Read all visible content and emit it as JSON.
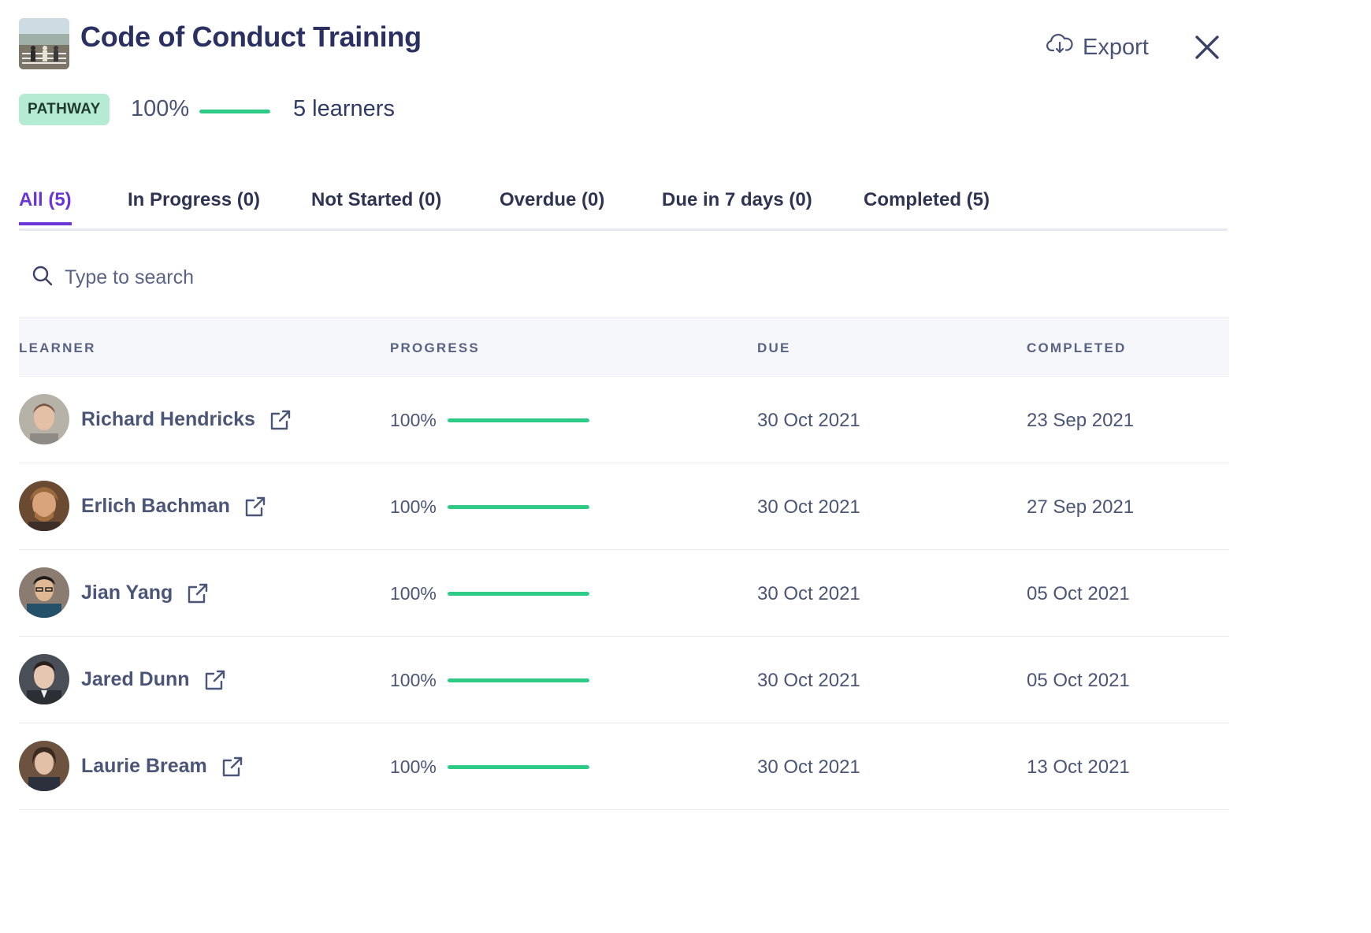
{
  "header": {
    "title": "Code of Conduct Training",
    "export_label": "Export",
    "badge": "PATHWAY",
    "overall_progress_label": "100%",
    "overall_progress_fraction": 1.0,
    "learners_label": "5 learners"
  },
  "tabs": [
    {
      "label": "All (5)",
      "active": true
    },
    {
      "label": "In Progress (0)",
      "active": false
    },
    {
      "label": "Not Started (0)",
      "active": false
    },
    {
      "label": "Overdue (0)",
      "active": false
    },
    {
      "label": "Due in 7 days (0)",
      "active": false
    },
    {
      "label": "Completed (5)",
      "active": false
    }
  ],
  "search": {
    "placeholder": "Type to search",
    "value": ""
  },
  "table": {
    "headers": [
      "LEARNER",
      "PROGRESS",
      "DUE",
      "COMPLETED"
    ],
    "rows": [
      {
        "name": "Richard Hendricks",
        "progress_label": "100%",
        "progress_fraction": 1.0,
        "due": "30 Oct 2021",
        "completed": "23 Sep 2021"
      },
      {
        "name": "Erlich Bachman",
        "progress_label": "100%",
        "progress_fraction": 1.0,
        "due": "30 Oct 2021",
        "completed": "27 Sep 2021"
      },
      {
        "name": "Jian Yang",
        "progress_label": "100%",
        "progress_fraction": 1.0,
        "due": "30 Oct 2021",
        "completed": "05 Oct 2021"
      },
      {
        "name": "Jared Dunn",
        "progress_label": "100%",
        "progress_fraction": 1.0,
        "due": "30 Oct 2021",
        "completed": "05 Oct 2021"
      },
      {
        "name": "Laurie Bream",
        "progress_label": "100%",
        "progress_fraction": 1.0,
        "due": "30 Oct 2021",
        "completed": "13 Oct 2021"
      }
    ]
  },
  "icons": {
    "export": "cloud-download-icon",
    "close": "close-icon",
    "search": "search-icon",
    "open_profile": "external-link-icon"
  },
  "colors": {
    "accent": "#6a35d6",
    "progress": "#2ecb86",
    "badge_bg": "#b6ebd3",
    "title": "#2b3062"
  }
}
